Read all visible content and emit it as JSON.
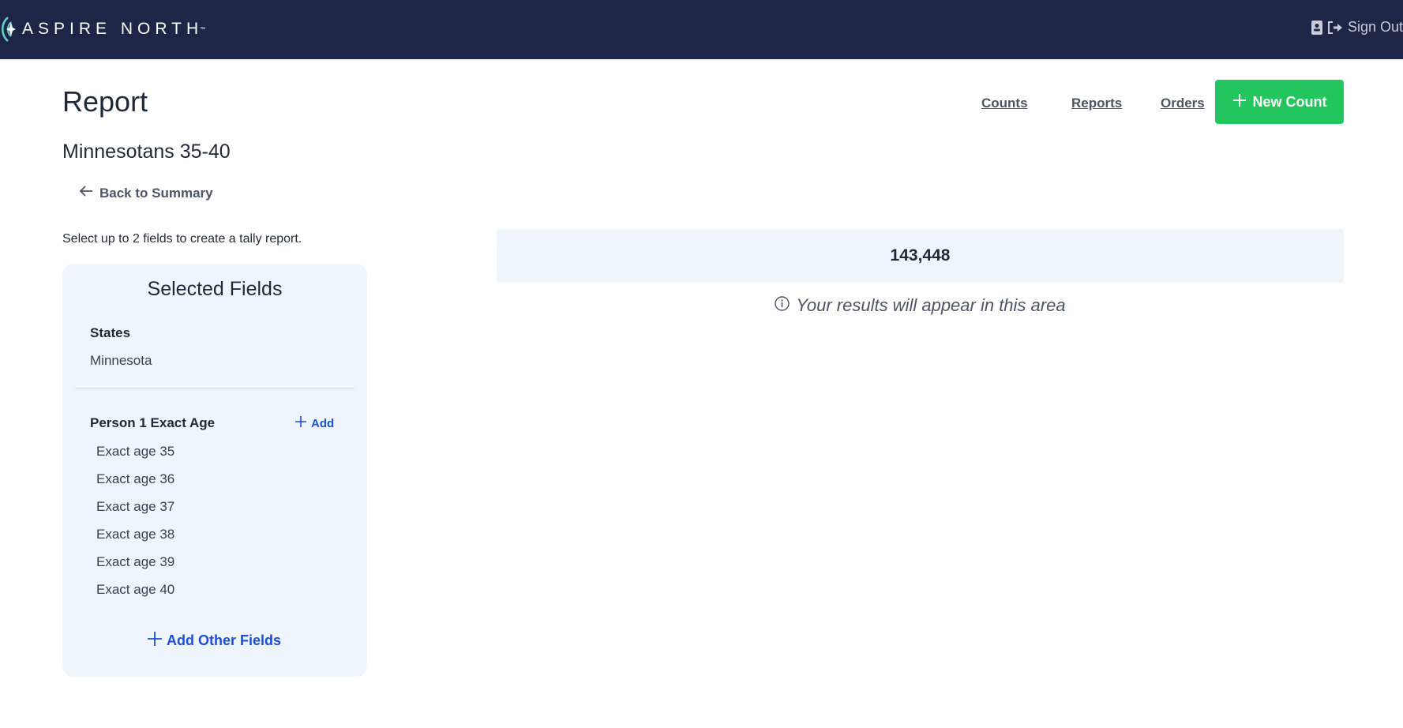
{
  "brand": {
    "name": "ASPIRE NORTH",
    "trademark": "™"
  },
  "topbar": {
    "sign_out_label": "Sign Out"
  },
  "header": {
    "title": "Report",
    "report_name": "Minnesotans 35-40",
    "back_label": "Back to Summary"
  },
  "nav": {
    "counts": "Counts",
    "reports": "Reports",
    "orders": "Orders",
    "new_count": "New Count"
  },
  "instructions": "Select up to 2 fields to create a tally report.",
  "selected_fields": {
    "title": "Selected Fields",
    "states": {
      "label": "States",
      "value": "Minnesota"
    },
    "age": {
      "label": "Person 1 Exact Age",
      "add_label": "Add",
      "items": [
        "Exact age 35",
        "Exact age 36",
        "Exact age 37",
        "Exact age 38",
        "Exact age 39",
        "Exact age 40"
      ]
    },
    "add_other_label": "Add Other Fields"
  },
  "results": {
    "total": "143,448",
    "hint": "Your results will appear in this area"
  },
  "colors": {
    "topbar": "#1e2547",
    "accent_green": "#22c55e",
    "link_blue": "#1d4ed8",
    "panel_bg": "#eff5fd"
  }
}
